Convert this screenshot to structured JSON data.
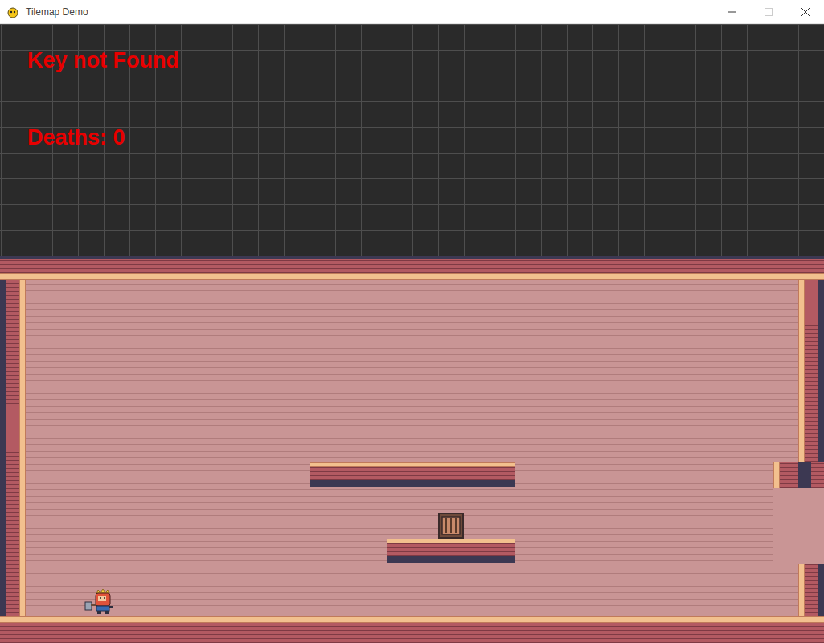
{
  "window": {
    "title": "Tilemap Demo"
  },
  "hud": {
    "key_status": "Key not Found",
    "deaths": "Deaths: 0"
  }
}
